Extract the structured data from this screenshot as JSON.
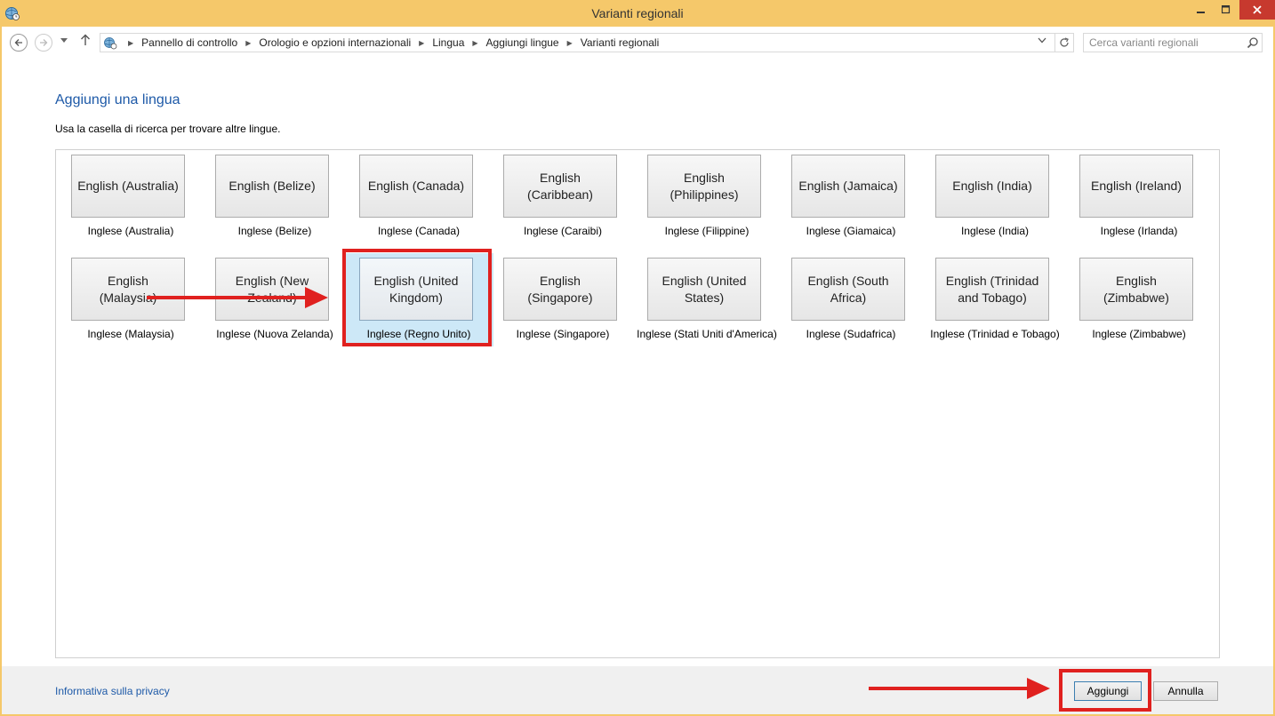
{
  "window": {
    "title": "Varianti regionali"
  },
  "address_bar": {
    "breadcrumbs": [
      "Pannello di controllo",
      "Orologio e opzioni internazionali",
      "Lingua",
      "Aggiungi lingue",
      "Varianti regionali"
    ]
  },
  "search": {
    "placeholder": "Cerca varianti regionali"
  },
  "main": {
    "title": "Aggiungi una lingua",
    "instructions": "Usa la casella di ricerca per trovare altre lingue."
  },
  "languages": [
    {
      "name": "English (Australia)",
      "caption": "Inglese (Australia)"
    },
    {
      "name": "English (Belize)",
      "caption": "Inglese (Belize)"
    },
    {
      "name": "English (Canada)",
      "caption": "Inglese (Canada)"
    },
    {
      "name": "English (Caribbean)",
      "caption": "Inglese (Caraibi)"
    },
    {
      "name": "English (Philippines)",
      "caption": "Inglese (Filippine)"
    },
    {
      "name": "English (Jamaica)",
      "caption": "Inglese (Giamaica)"
    },
    {
      "name": "English (India)",
      "caption": "Inglese (India)"
    },
    {
      "name": "English (Ireland)",
      "caption": "Inglese (Irlanda)"
    },
    {
      "name": "English (Malaysia)",
      "caption": "Inglese (Malaysia)"
    },
    {
      "name": "English (New Zealand)",
      "caption": "Inglese (Nuova Zelanda)"
    },
    {
      "name": "English (United Kingdom)",
      "caption": "Inglese (Regno Unito)",
      "selected": true
    },
    {
      "name": "English (Singapore)",
      "caption": "Inglese (Singapore)"
    },
    {
      "name": "English (United States)",
      "caption": "Inglese (Stati Uniti d'America)"
    },
    {
      "name": "English (South Africa)",
      "caption": "Inglese (Sudafrica)"
    },
    {
      "name": "English (Trinidad and Tobago)",
      "caption": "Inglese (Trinidad e Tobago)"
    },
    {
      "name": "English (Zimbabwe)",
      "caption": "Inglese (Zimbabwe)"
    }
  ],
  "footer": {
    "privacy_link": "Informativa sulla privacy",
    "add_button": "Aggiungi",
    "cancel_button": "Annulla"
  },
  "colors": {
    "title_bar": "#f5c86a",
    "link_blue": "#1e5aa8",
    "selection": "#cde8f7",
    "annotation_red": "#e0211f",
    "close_button": "#c7392e"
  },
  "icons": {
    "app": "globe-clock-icon",
    "back": "back-arrow-icon",
    "forward": "forward-arrow-icon",
    "up": "up-arrow-icon",
    "refresh": "refresh-icon",
    "search": "search-icon"
  }
}
